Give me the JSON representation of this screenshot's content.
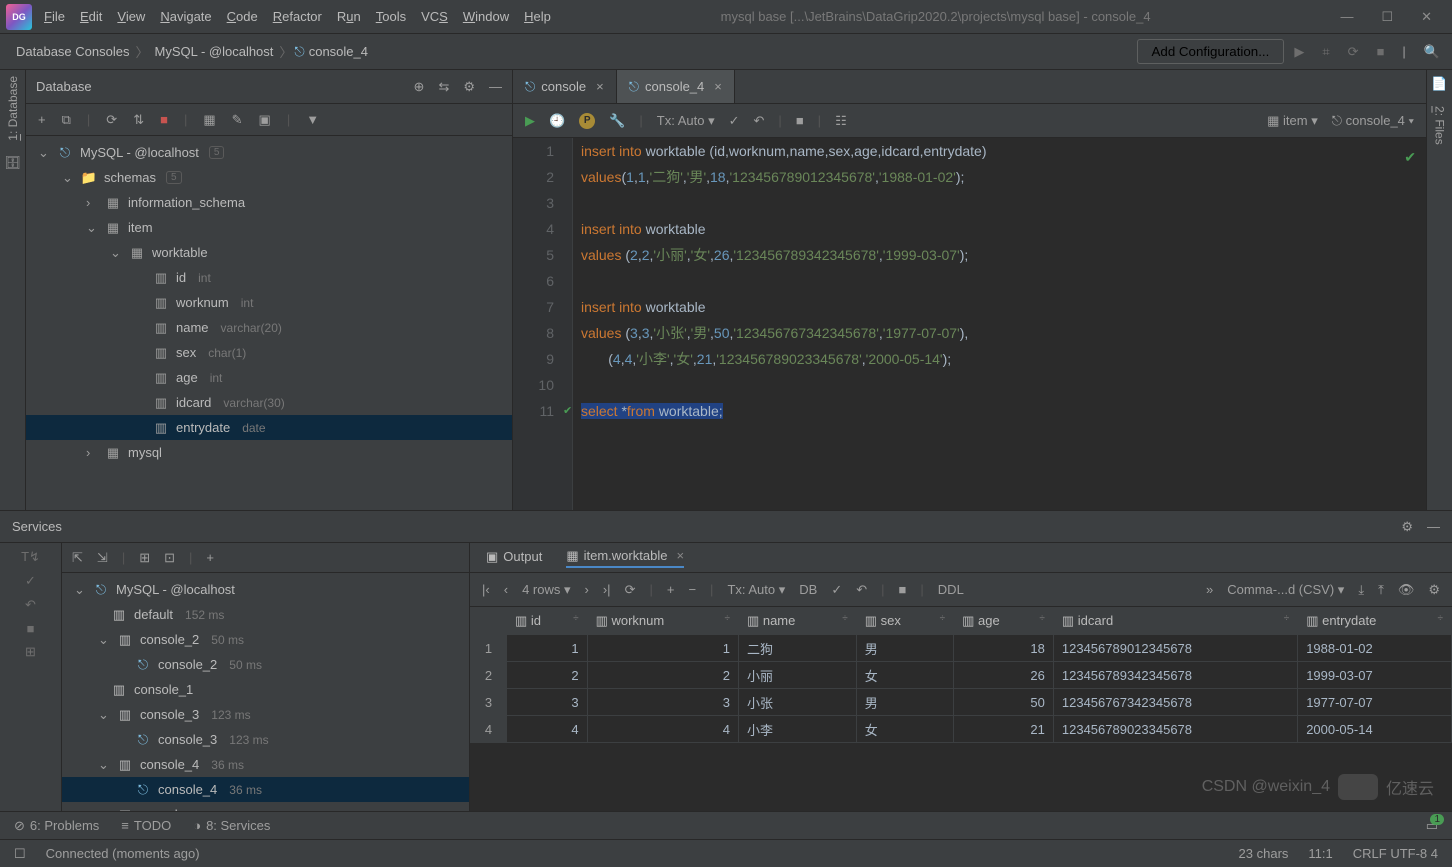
{
  "title_path": "mysql base [...\\JetBrains\\DataGrip2020.2\\projects\\mysql base] - console_4",
  "menu": [
    "File",
    "Edit",
    "View",
    "Navigate",
    "Code",
    "Refactor",
    "Run",
    "Tools",
    "VCS",
    "Window",
    "Help"
  ],
  "breadcrumbs": [
    "Database Consoles",
    "MySQL - @localhost",
    "console_4"
  ],
  "add_config": "Add Configuration...",
  "db_panel": {
    "title": "Database"
  },
  "tree": {
    "root": {
      "label": "MySQL - @localhost",
      "count": "5"
    },
    "schemas": {
      "label": "schemas",
      "count": "5"
    },
    "info_schema": "information_schema",
    "item": "item",
    "worktable": "worktable",
    "cols": [
      {
        "name": "id",
        "type": "int"
      },
      {
        "name": "worknum",
        "type": "int"
      },
      {
        "name": "name",
        "type": "varchar(20)"
      },
      {
        "name": "sex",
        "type": "char(1)"
      },
      {
        "name": "age",
        "type": "int"
      },
      {
        "name": "idcard",
        "type": "varchar(30)"
      },
      {
        "name": "entrydate",
        "type": "date"
      }
    ],
    "mysql": "mysql"
  },
  "tabs": [
    {
      "label": "console",
      "active": false
    },
    {
      "label": "console_4",
      "active": true
    }
  ],
  "ed_tx": "Tx: Auto",
  "ed_item": "item",
  "ed_console": "console_4",
  "code_lines": 11,
  "services": {
    "title": "Services"
  },
  "svc_tree": {
    "root": "MySQL - @localhost",
    "default": {
      "label": "default",
      "time": "152 ms"
    },
    "c2": {
      "label": "console_2",
      "time": "50 ms"
    },
    "c2b": {
      "label": "console_2",
      "time": "50 ms"
    },
    "c1": {
      "label": "console_1"
    },
    "c3": {
      "label": "console_3",
      "time": "123 ms"
    },
    "c3b": {
      "label": "console_3",
      "time": "123 ms"
    },
    "c4": {
      "label": "console_4",
      "time": "36 ms"
    },
    "c4b": {
      "label": "console_4",
      "time": "36 ms"
    },
    "cc": {
      "label": "console"
    }
  },
  "result_tabs": [
    "Output",
    "item.worktable"
  ],
  "rows_label": "4 rows",
  "res_tx": "Tx: Auto",
  "ddl": "DDL",
  "csv": "Comma-...d (CSV)",
  "grid_cols": [
    "id",
    "worknum",
    "name",
    "sex",
    "age",
    "idcard",
    "entrydate"
  ],
  "grid_rows": [
    {
      "id": 1,
      "worknum": 1,
      "name": "二狗",
      "sex": "男",
      "age": 18,
      "idcard": "123456789012345678",
      "entrydate": "1988-01-02"
    },
    {
      "id": 2,
      "worknum": 2,
      "name": "小丽",
      "sex": "女",
      "age": 26,
      "idcard": "123456789342345678",
      "entrydate": "1999-03-07"
    },
    {
      "id": 3,
      "worknum": 3,
      "name": "小张",
      "sex": "男",
      "age": 50,
      "idcard": "123456767342345678",
      "entrydate": "1977-07-07"
    },
    {
      "id": 4,
      "worknum": 4,
      "name": "小李",
      "sex": "女",
      "age": 21,
      "idcard": "123456789023345678",
      "entrydate": "2000-05-14"
    }
  ],
  "bottom_tabs": [
    "6: Problems",
    "TODO",
    "8: Services"
  ],
  "status": {
    "msg": "Connected (moments ago)",
    "chars": "23 chars",
    "pos": "11:1",
    "encoding": "CRLF  UTF-8  4",
    "watermark": "CSDN @weixin_4",
    "watermark2": "亿速云"
  },
  "sql": {
    "l1a": "insert",
    "l1b": "into",
    "l1c": "worktable",
    "l1d": "id",
    "l1e": "worknum",
    "l1f": "name",
    "l1g": "sex",
    "l1h": "age",
    "l1i": "idcard",
    "l1j": "entrydate",
    "l2a": "values",
    "l2n1": "1",
    "l2n2": "1",
    "l2s1": "'二狗'",
    "l2s2": "'男'",
    "l2n3": "18",
    "l2s3": "'123456789012345678'",
    "l2s4": "'1988-01-02'",
    "l4a": "insert",
    "l4b": "into",
    "l4c": "worktable",
    "l5a": "values",
    "l5n1": "2",
    "l5n2": "2",
    "l5s1": "'小丽'",
    "l5s2": "'女'",
    "l5n3": "26",
    "l5s3": "'123456789342345678'",
    "l5s4": "'1999-03-07'",
    "l7a": "insert",
    "l7b": "into",
    "l7c": "worktable",
    "l8a": "values",
    "l8n1": "3",
    "l8n2": "3",
    "l8s1": "'小张'",
    "l8s2": "'男'",
    "l8n3": "50",
    "l8s3": "'123456767342345678'",
    "l8s4": "'1977-07-07'",
    "l9n1": "4",
    "l9n2": "4",
    "l9s1": "'小李'",
    "l9s2": "'女'",
    "l9n3": "21",
    "l9s3": "'123456789023345678'",
    "l9s4": "'2000-05-14'",
    "l11a": "select",
    "l11b": "from",
    "l11c": "worktable"
  }
}
